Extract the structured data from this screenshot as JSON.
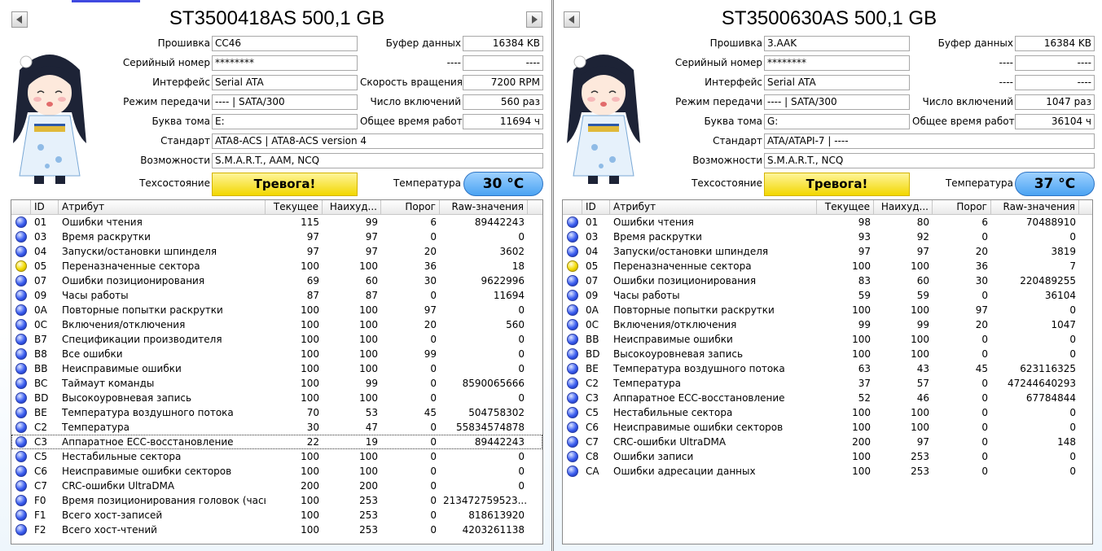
{
  "labels": {
    "firmware": "Прошивка",
    "serial": "Серийный номер",
    "interface": "Интерфейс",
    "transfer_mode": "Режим передачи",
    "drive_letter": "Буква тома",
    "standard": "Стандарт",
    "features": "Возможности",
    "health": "Техсостояние",
    "buffer": "Буфер данных",
    "rotation": "Скорость вращения",
    "power_on_count": "Число включений",
    "power_on_hours": "Общее время работы",
    "temperature": "Температура"
  },
  "columns": [
    "ID",
    "Атрибут",
    "Текущее",
    "Наихуд...",
    "Порог",
    "Raw-значения"
  ],
  "colors": {
    "ok_dot": "#3a5df0",
    "warn_dot": "#f2da00",
    "status_bg": "#f2d700",
    "temp_bg": "#4aa3f2",
    "accent_line": "#3f49e0"
  },
  "left": {
    "title": "ST3500418AS 500,1 GB",
    "firmware": "CC46",
    "serial": "********",
    "interface": "Serial ATA",
    "transfer_mode": "---- | SATA/300",
    "drive_letter": "E:",
    "standard": "ATA8-ACS | ATA8-ACS version 4",
    "features": "S.M.A.R.T., AAM, NCQ",
    "health": "Тревога!",
    "buffer": "16384 KB",
    "right2_label": "----",
    "right2_value": "----",
    "rotation": "7200 RPM",
    "power_on_count": "560 раз",
    "power_on_hours": "11694 ч",
    "temperature": "30 °C",
    "rows": [
      {
        "status": "ok",
        "id": "01",
        "name": "Ошибки чтения",
        "cur": "115",
        "worst": "99",
        "thr": "6",
        "raw": "89442243"
      },
      {
        "status": "ok",
        "id": "03",
        "name": "Время раскрутки",
        "cur": "97",
        "worst": "97",
        "thr": "0",
        "raw": "0"
      },
      {
        "status": "ok",
        "id": "04",
        "name": "Запуски/остановки шпинделя",
        "cur": "97",
        "worst": "97",
        "thr": "20",
        "raw": "3602"
      },
      {
        "status": "warn",
        "id": "05",
        "name": "Переназначенные сектора",
        "cur": "100",
        "worst": "100",
        "thr": "36",
        "raw": "18"
      },
      {
        "status": "ok",
        "id": "07",
        "name": "Ошибки позиционирования",
        "cur": "69",
        "worst": "60",
        "thr": "30",
        "raw": "9622996"
      },
      {
        "status": "ok",
        "id": "09",
        "name": "Часы работы",
        "cur": "87",
        "worst": "87",
        "thr": "0",
        "raw": "11694"
      },
      {
        "status": "ok",
        "id": "0A",
        "name": "Повторные попытки раскрутки",
        "cur": "100",
        "worst": "100",
        "thr": "97",
        "raw": "0"
      },
      {
        "status": "ok",
        "id": "0C",
        "name": "Включения/отключения",
        "cur": "100",
        "worst": "100",
        "thr": "20",
        "raw": "560"
      },
      {
        "status": "ok",
        "id": "B7",
        "name": "Спецификации производителя",
        "cur": "100",
        "worst": "100",
        "thr": "0",
        "raw": "0"
      },
      {
        "status": "ok",
        "id": "B8",
        "name": "Все ошибки",
        "cur": "100",
        "worst": "100",
        "thr": "99",
        "raw": "0"
      },
      {
        "status": "ok",
        "id": "BB",
        "name": "Неисправимые ошибки",
        "cur": "100",
        "worst": "100",
        "thr": "0",
        "raw": "0"
      },
      {
        "status": "ok",
        "id": "BC",
        "name": "Таймаут команды",
        "cur": "100",
        "worst": "99",
        "thr": "0",
        "raw": "8590065666"
      },
      {
        "status": "ok",
        "id": "BD",
        "name": "Высокоуровневая запись",
        "cur": "100",
        "worst": "100",
        "thr": "0",
        "raw": "0"
      },
      {
        "status": "ok",
        "id": "BE",
        "name": "Температура воздушного потока",
        "cur": "70",
        "worst": "53",
        "thr": "45",
        "raw": "504758302"
      },
      {
        "status": "ok",
        "id": "C2",
        "name": "Температура",
        "cur": "30",
        "worst": "47",
        "thr": "0",
        "raw": "55834574878"
      },
      {
        "status": "ok",
        "id": "C3",
        "name": "Аппаратное ECC-восстановление",
        "cur": "22",
        "worst": "19",
        "thr": "0",
        "raw": "89442243",
        "selected": true
      },
      {
        "status": "ok",
        "id": "C5",
        "name": "Нестабильные сектора",
        "cur": "100",
        "worst": "100",
        "thr": "0",
        "raw": "0"
      },
      {
        "status": "ok",
        "id": "C6",
        "name": "Неисправимые ошибки секторов",
        "cur": "100",
        "worst": "100",
        "thr": "0",
        "raw": "0"
      },
      {
        "status": "ok",
        "id": "C7",
        "name": "CRC-ошибки UltraDMA",
        "cur": "200",
        "worst": "200",
        "thr": "0",
        "raw": "0"
      },
      {
        "status": "ok",
        "id": "F0",
        "name": "Время позиционирования головок (часы)",
        "cur": "100",
        "worst": "253",
        "thr": "0",
        "raw": "213472759523..."
      },
      {
        "status": "ok",
        "id": "F1",
        "name": "Всего хост-записей",
        "cur": "100",
        "worst": "253",
        "thr": "0",
        "raw": "818613920"
      },
      {
        "status": "ok",
        "id": "F2",
        "name": "Всего хост-чтений",
        "cur": "100",
        "worst": "253",
        "thr": "0",
        "raw": "4203261138"
      }
    ]
  },
  "right": {
    "title": "ST3500630AS 500,1 GB",
    "firmware": "3.AAK",
    "serial": "********",
    "interface": "Serial ATA",
    "transfer_mode": "---- | SATA/300",
    "drive_letter": "G:",
    "standard": "ATA/ATAPI-7 | ----",
    "features": "S.M.A.R.T., NCQ",
    "health": "Тревога!",
    "buffer": "16384 KB",
    "right2_label": "----",
    "right2_value": "----",
    "rotation_label": "----",
    "rotation": "----",
    "power_on_count": "1047 раз",
    "power_on_hours": "36104 ч",
    "temperature": "37 °C",
    "rows": [
      {
        "status": "ok",
        "id": "01",
        "name": "Ошибки чтения",
        "cur": "98",
        "worst": "80",
        "thr": "6",
        "raw": "70488910"
      },
      {
        "status": "ok",
        "id": "03",
        "name": "Время раскрутки",
        "cur": "93",
        "worst": "92",
        "thr": "0",
        "raw": "0"
      },
      {
        "status": "ok",
        "id": "04",
        "name": "Запуски/остановки шпинделя",
        "cur": "97",
        "worst": "97",
        "thr": "20",
        "raw": "3819"
      },
      {
        "status": "warn",
        "id": "05",
        "name": "Переназначенные сектора",
        "cur": "100",
        "worst": "100",
        "thr": "36",
        "raw": "7"
      },
      {
        "status": "ok",
        "id": "07",
        "name": "Ошибки позиционирования",
        "cur": "83",
        "worst": "60",
        "thr": "30",
        "raw": "220489255"
      },
      {
        "status": "ok",
        "id": "09",
        "name": "Часы работы",
        "cur": "59",
        "worst": "59",
        "thr": "0",
        "raw": "36104"
      },
      {
        "status": "ok",
        "id": "0A",
        "name": "Повторные попытки раскрутки",
        "cur": "100",
        "worst": "100",
        "thr": "97",
        "raw": "0"
      },
      {
        "status": "ok",
        "id": "0C",
        "name": "Включения/отключения",
        "cur": "99",
        "worst": "99",
        "thr": "20",
        "raw": "1047"
      },
      {
        "status": "ok",
        "id": "BB",
        "name": "Неисправимые ошибки",
        "cur": "100",
        "worst": "100",
        "thr": "0",
        "raw": "0"
      },
      {
        "status": "ok",
        "id": "BD",
        "name": "Высокоуровневая запись",
        "cur": "100",
        "worst": "100",
        "thr": "0",
        "raw": "0"
      },
      {
        "status": "ok",
        "id": "BE",
        "name": "Температура воздушного потока",
        "cur": "63",
        "worst": "43",
        "thr": "45",
        "raw": "623116325"
      },
      {
        "status": "ok",
        "id": "C2",
        "name": "Температура",
        "cur": "37",
        "worst": "57",
        "thr": "0",
        "raw": "47244640293"
      },
      {
        "status": "ok",
        "id": "C3",
        "name": "Аппаратное ECC-восстановление",
        "cur": "52",
        "worst": "46",
        "thr": "0",
        "raw": "67784844"
      },
      {
        "status": "ok",
        "id": "C5",
        "name": "Нестабильные сектора",
        "cur": "100",
        "worst": "100",
        "thr": "0",
        "raw": "0"
      },
      {
        "status": "ok",
        "id": "C6",
        "name": "Неисправимые ошибки секторов",
        "cur": "100",
        "worst": "100",
        "thr": "0",
        "raw": "0"
      },
      {
        "status": "ok",
        "id": "C7",
        "name": "CRC-ошибки UltraDMA",
        "cur": "200",
        "worst": "97",
        "thr": "0",
        "raw": "148"
      },
      {
        "status": "ok",
        "id": "C8",
        "name": "Ошибки записи",
        "cur": "100",
        "worst": "253",
        "thr": "0",
        "raw": "0"
      },
      {
        "status": "ok",
        "id": "CA",
        "name": "Ошибки адресации данных",
        "cur": "100",
        "worst": "253",
        "thr": "0",
        "raw": "0"
      }
    ]
  }
}
